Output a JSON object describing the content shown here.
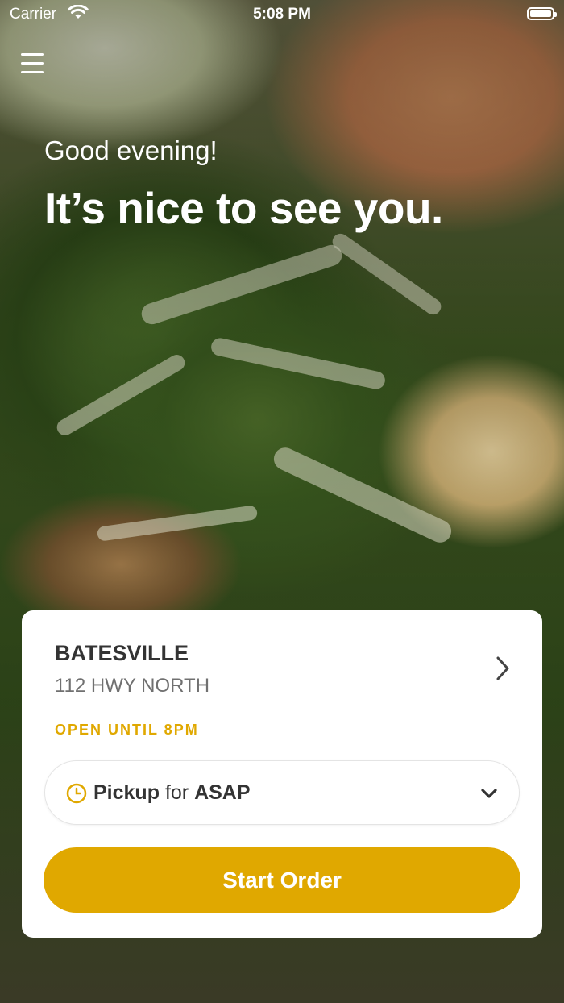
{
  "status_bar": {
    "carrier": "Carrier",
    "time": "5:08 PM"
  },
  "hero": {
    "greeting": "Good evening!",
    "headline": "It’s nice to see you."
  },
  "location": {
    "name": "BATESVILLE",
    "address": "112 HWY NORTH",
    "hours": "OPEN UNTIL 8PM"
  },
  "order_mode": {
    "method": "Pickup",
    "connector": "for",
    "time": "ASAP"
  },
  "actions": {
    "start_order_label": "Start Order"
  },
  "icons": {
    "menu": "menu-icon",
    "wifi": "wifi-icon",
    "battery": "battery-icon",
    "location_chevron": "chevron-right-icon",
    "clock": "clock-icon",
    "dropdown": "chevron-down-icon"
  },
  "colors": {
    "accent": "#e0a800",
    "card_background": "#ffffff",
    "primary_text": "#333333",
    "secondary_text": "#707070"
  }
}
